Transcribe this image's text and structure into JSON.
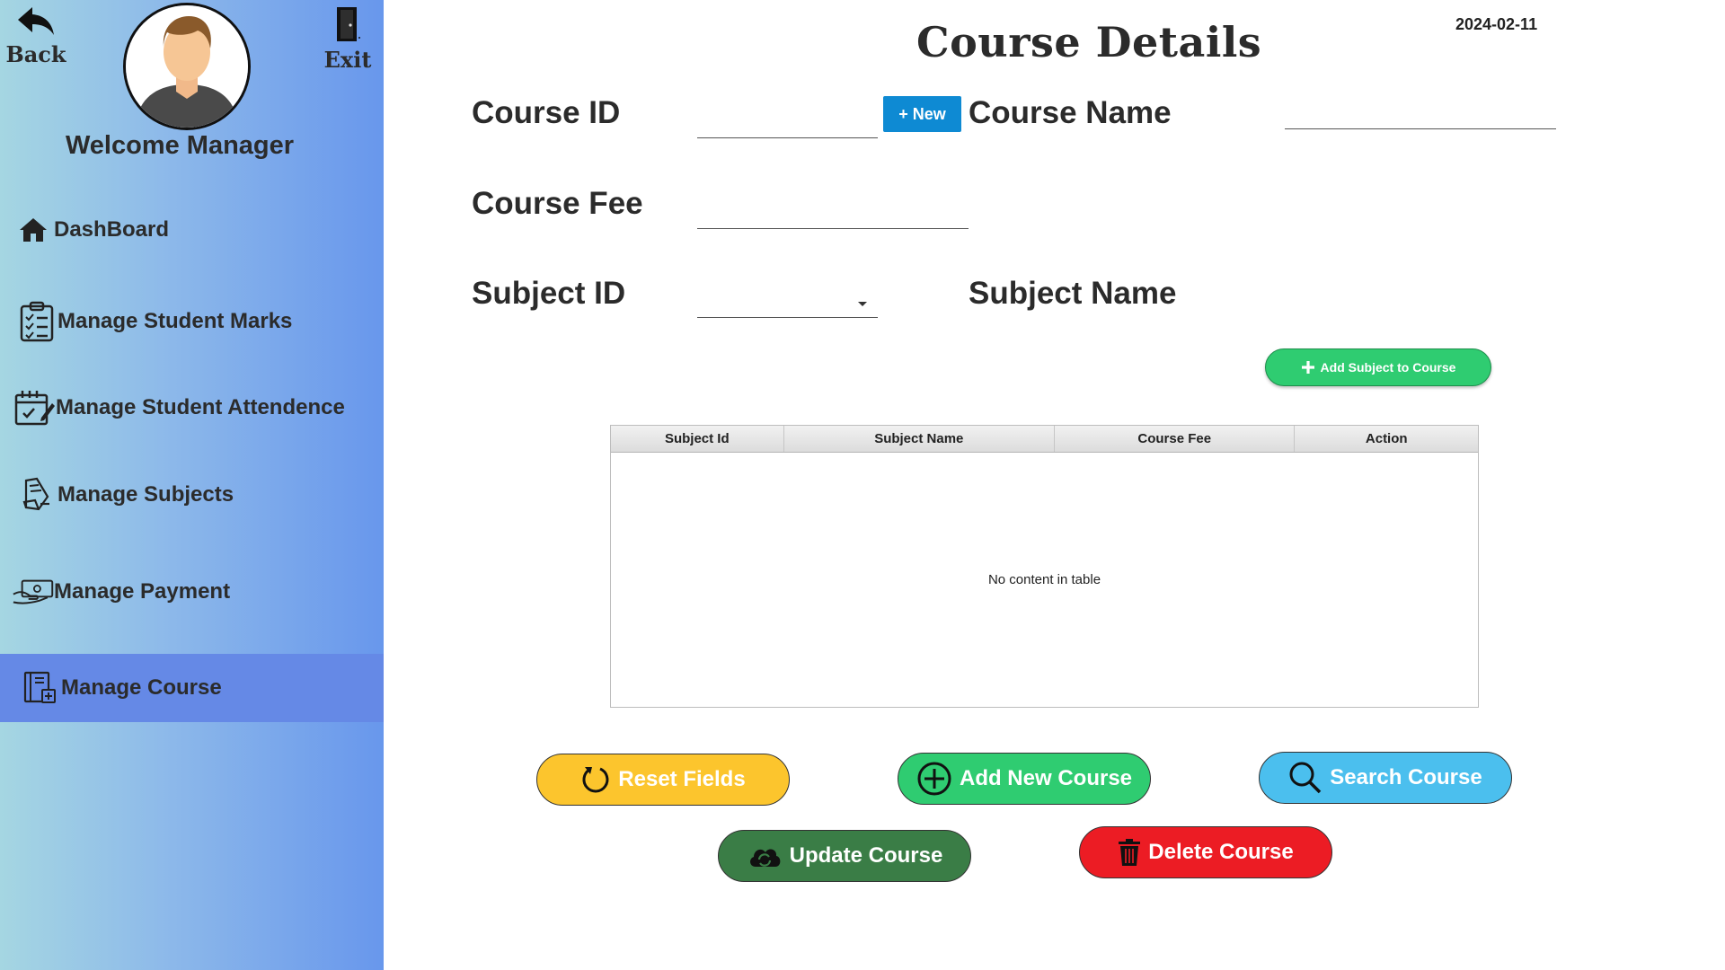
{
  "sidebar": {
    "back_label": "Back",
    "exit_label": "Exit",
    "welcome": "Welcome Manager",
    "items": [
      {
        "label": "DashBoard",
        "icon": "home-icon"
      },
      {
        "label": "Manage Student Marks",
        "icon": "clipboard-checklist-icon"
      },
      {
        "label": "Manage Student Attendence",
        "icon": "calendar-edit-icon"
      },
      {
        "label": "Manage Subjects",
        "icon": "book-icon"
      },
      {
        "label": "Manage Payment",
        "icon": "hand-cash-icon"
      },
      {
        "label": "Manage Course",
        "icon": "course-book-icon",
        "active": true
      }
    ],
    "active_color": "#6589e6"
  },
  "header": {
    "title": "Course Details",
    "date": "2024-02-11"
  },
  "form": {
    "course_id_label": "Course ID",
    "course_id_value": "",
    "new_button": "+ New",
    "course_name_label": "Course Name",
    "course_name_value": "",
    "course_fee_label": "Course Fee",
    "course_fee_value": "",
    "subject_id_label": "Subject ID",
    "subject_id_value": "",
    "subject_name_label": "Subject Name",
    "add_subject_button": "Add Subject to Course"
  },
  "table": {
    "columns": [
      "Subject Id",
      "Subject Name",
      "Course Fee",
      "Action"
    ],
    "rows": [],
    "empty_message": "No content in table"
  },
  "actions": {
    "reset": "Reset Fields",
    "add": "Add New Course",
    "search": "Search Course",
    "update": "Update Course",
    "delete": "Delete Course"
  },
  "colors": {
    "reset": "#fcc52d",
    "add": "#2fcc71",
    "search": "#4bbfee",
    "update": "#3a7d46",
    "delete": "#ec1c24",
    "new_button": "#0e8ad3"
  }
}
